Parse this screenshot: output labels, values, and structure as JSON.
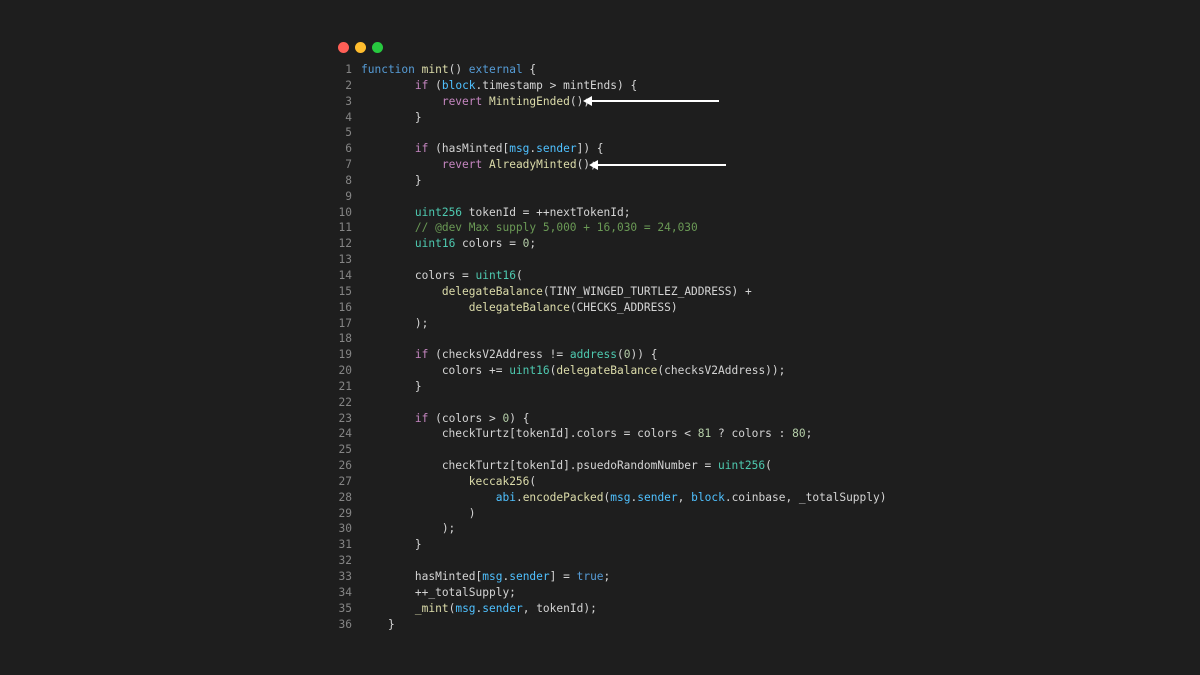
{
  "window": {
    "controls": [
      {
        "name": "close",
        "color": "#ff5f56"
      },
      {
        "name": "minimize",
        "color": "#ffbd2e"
      },
      {
        "name": "maximize",
        "color": "#27c93f"
      }
    ]
  },
  "colors": {
    "kw": "#c586c0",
    "fn": "#dcdcaa",
    "type": "#4ec9b0",
    "var": "#4fc1ff",
    "num": "#b5cea8",
    "comment": "#6a9955",
    "blue": "#569cd6",
    "plain": "#d4d4d4"
  },
  "code": {
    "lines": [
      {
        "n": "1",
        "tokens": [
          [
            "blue",
            "function "
          ],
          [
            "fn",
            "mint"
          ],
          [
            "plain",
            "() "
          ],
          [
            "blue",
            "external"
          ],
          [
            "plain",
            " {"
          ]
        ]
      },
      {
        "n": "2",
        "tokens": [
          [
            "plain",
            "        "
          ],
          [
            "kw",
            "if"
          ],
          [
            "plain",
            " ("
          ],
          [
            "var",
            "block"
          ],
          [
            "plain",
            ".timestamp > mintEnds) {"
          ]
        ]
      },
      {
        "n": "3",
        "tokens": [
          [
            "plain",
            "            "
          ],
          [
            "kw",
            "revert"
          ],
          [
            "plain",
            " "
          ],
          [
            "fn",
            "MintingEnded"
          ],
          [
            "plain",
            "();"
          ]
        ]
      },
      {
        "n": "4",
        "tokens": [
          [
            "plain",
            "        }"
          ]
        ]
      },
      {
        "n": "5",
        "tokens": []
      },
      {
        "n": "6",
        "tokens": [
          [
            "plain",
            "        "
          ],
          [
            "kw",
            "if"
          ],
          [
            "plain",
            " (hasMinted["
          ],
          [
            "var",
            "msg"
          ],
          [
            "plain",
            "."
          ],
          [
            "var",
            "sender"
          ],
          [
            "plain",
            "]) {"
          ]
        ]
      },
      {
        "n": "7",
        "tokens": [
          [
            "plain",
            "            "
          ],
          [
            "kw",
            "revert"
          ],
          [
            "plain",
            " "
          ],
          [
            "fn",
            "AlreadyMinted"
          ],
          [
            "plain",
            "();"
          ]
        ]
      },
      {
        "n": "8",
        "tokens": [
          [
            "plain",
            "        }"
          ]
        ]
      },
      {
        "n": "9",
        "tokens": []
      },
      {
        "n": "10",
        "tokens": [
          [
            "plain",
            "        "
          ],
          [
            "type",
            "uint256"
          ],
          [
            "plain",
            " tokenId = ++nextTokenId;"
          ]
        ]
      },
      {
        "n": "11",
        "tokens": [
          [
            "plain",
            "        "
          ],
          [
            "comment",
            "// @dev Max supply 5,000 + 16,030 = 24,030"
          ]
        ]
      },
      {
        "n": "12",
        "tokens": [
          [
            "plain",
            "        "
          ],
          [
            "type",
            "uint16"
          ],
          [
            "plain",
            " colors = "
          ],
          [
            "num",
            "0"
          ],
          [
            "plain",
            ";"
          ]
        ]
      },
      {
        "n": "13",
        "tokens": []
      },
      {
        "n": "14",
        "tokens": [
          [
            "plain",
            "        colors = "
          ],
          [
            "type",
            "uint16"
          ],
          [
            "plain",
            "("
          ]
        ]
      },
      {
        "n": "15",
        "tokens": [
          [
            "plain",
            "            "
          ],
          [
            "fn",
            "delegateBalance"
          ],
          [
            "plain",
            "(TINY_WINGED_TURTLEZ_ADDRESS) +"
          ]
        ]
      },
      {
        "n": "16",
        "tokens": [
          [
            "plain",
            "                "
          ],
          [
            "fn",
            "delegateBalance"
          ],
          [
            "plain",
            "(CHECKS_ADDRESS)"
          ]
        ]
      },
      {
        "n": "17",
        "tokens": [
          [
            "plain",
            "        );"
          ]
        ]
      },
      {
        "n": "18",
        "tokens": []
      },
      {
        "n": "19",
        "tokens": [
          [
            "plain",
            "        "
          ],
          [
            "kw",
            "if"
          ],
          [
            "plain",
            " (checksV2Address != "
          ],
          [
            "type",
            "address"
          ],
          [
            "plain",
            "("
          ],
          [
            "num",
            "0"
          ],
          [
            "plain",
            ")) {"
          ]
        ]
      },
      {
        "n": "20",
        "tokens": [
          [
            "plain",
            "            colors += "
          ],
          [
            "type",
            "uint16"
          ],
          [
            "plain",
            "("
          ],
          [
            "fn",
            "delegateBalance"
          ],
          [
            "plain",
            "(checksV2Address));"
          ]
        ]
      },
      {
        "n": "21",
        "tokens": [
          [
            "plain",
            "        }"
          ]
        ]
      },
      {
        "n": "22",
        "tokens": []
      },
      {
        "n": "23",
        "tokens": [
          [
            "plain",
            "        "
          ],
          [
            "kw",
            "if"
          ],
          [
            "plain",
            " (colors > "
          ],
          [
            "num",
            "0"
          ],
          [
            "plain",
            ") {"
          ]
        ]
      },
      {
        "n": "24",
        "tokens": [
          [
            "plain",
            "            checkTurtz[tokenId].colors = colors < "
          ],
          [
            "num",
            "81"
          ],
          [
            "plain",
            " ? colors : "
          ],
          [
            "num",
            "80"
          ],
          [
            "plain",
            ";"
          ]
        ]
      },
      {
        "n": "25",
        "tokens": []
      },
      {
        "n": "26",
        "tokens": [
          [
            "plain",
            "            checkTurtz[tokenId].psuedoRandomNumber = "
          ],
          [
            "type",
            "uint256"
          ],
          [
            "plain",
            "("
          ]
        ]
      },
      {
        "n": "27",
        "tokens": [
          [
            "plain",
            "                "
          ],
          [
            "fn",
            "keccak256"
          ],
          [
            "plain",
            "("
          ]
        ]
      },
      {
        "n": "28",
        "tokens": [
          [
            "plain",
            "                    "
          ],
          [
            "var",
            "abi"
          ],
          [
            "plain",
            "."
          ],
          [
            "fn",
            "encodePacked"
          ],
          [
            "plain",
            "("
          ],
          [
            "var",
            "msg"
          ],
          [
            "plain",
            "."
          ],
          [
            "var",
            "sender"
          ],
          [
            "plain",
            ", "
          ],
          [
            "var",
            "block"
          ],
          [
            "plain",
            ".coinbase, _totalSupply)"
          ]
        ]
      },
      {
        "n": "29",
        "tokens": [
          [
            "plain",
            "                )"
          ]
        ]
      },
      {
        "n": "30",
        "tokens": [
          [
            "plain",
            "            );"
          ]
        ]
      },
      {
        "n": "31",
        "tokens": [
          [
            "plain",
            "        }"
          ]
        ]
      },
      {
        "n": "32",
        "tokens": []
      },
      {
        "n": "33",
        "tokens": [
          [
            "plain",
            "        hasMinted["
          ],
          [
            "var",
            "msg"
          ],
          [
            "plain",
            "."
          ],
          [
            "var",
            "sender"
          ],
          [
            "plain",
            "] = "
          ],
          [
            "blue",
            "true"
          ],
          [
            "plain",
            ";"
          ]
        ]
      },
      {
        "n": "34",
        "tokens": [
          [
            "plain",
            "        ++_totalSupply;"
          ]
        ]
      },
      {
        "n": "35",
        "tokens": [
          [
            "plain",
            "        "
          ],
          [
            "fn",
            "_mint"
          ],
          [
            "plain",
            "("
          ],
          [
            "var",
            "msg"
          ],
          [
            "plain",
            "."
          ],
          [
            "var",
            "sender"
          ],
          [
            "plain",
            ", tokenId);"
          ]
        ]
      },
      {
        "n": "36",
        "tokens": [
          [
            "plain",
            "    }"
          ]
        ]
      }
    ]
  },
  "annotations": {
    "arrows": [
      {
        "points_to_line": "3",
        "color": "#ffffff"
      },
      {
        "points_to_line": "7",
        "color": "#ffffff"
      }
    ]
  }
}
